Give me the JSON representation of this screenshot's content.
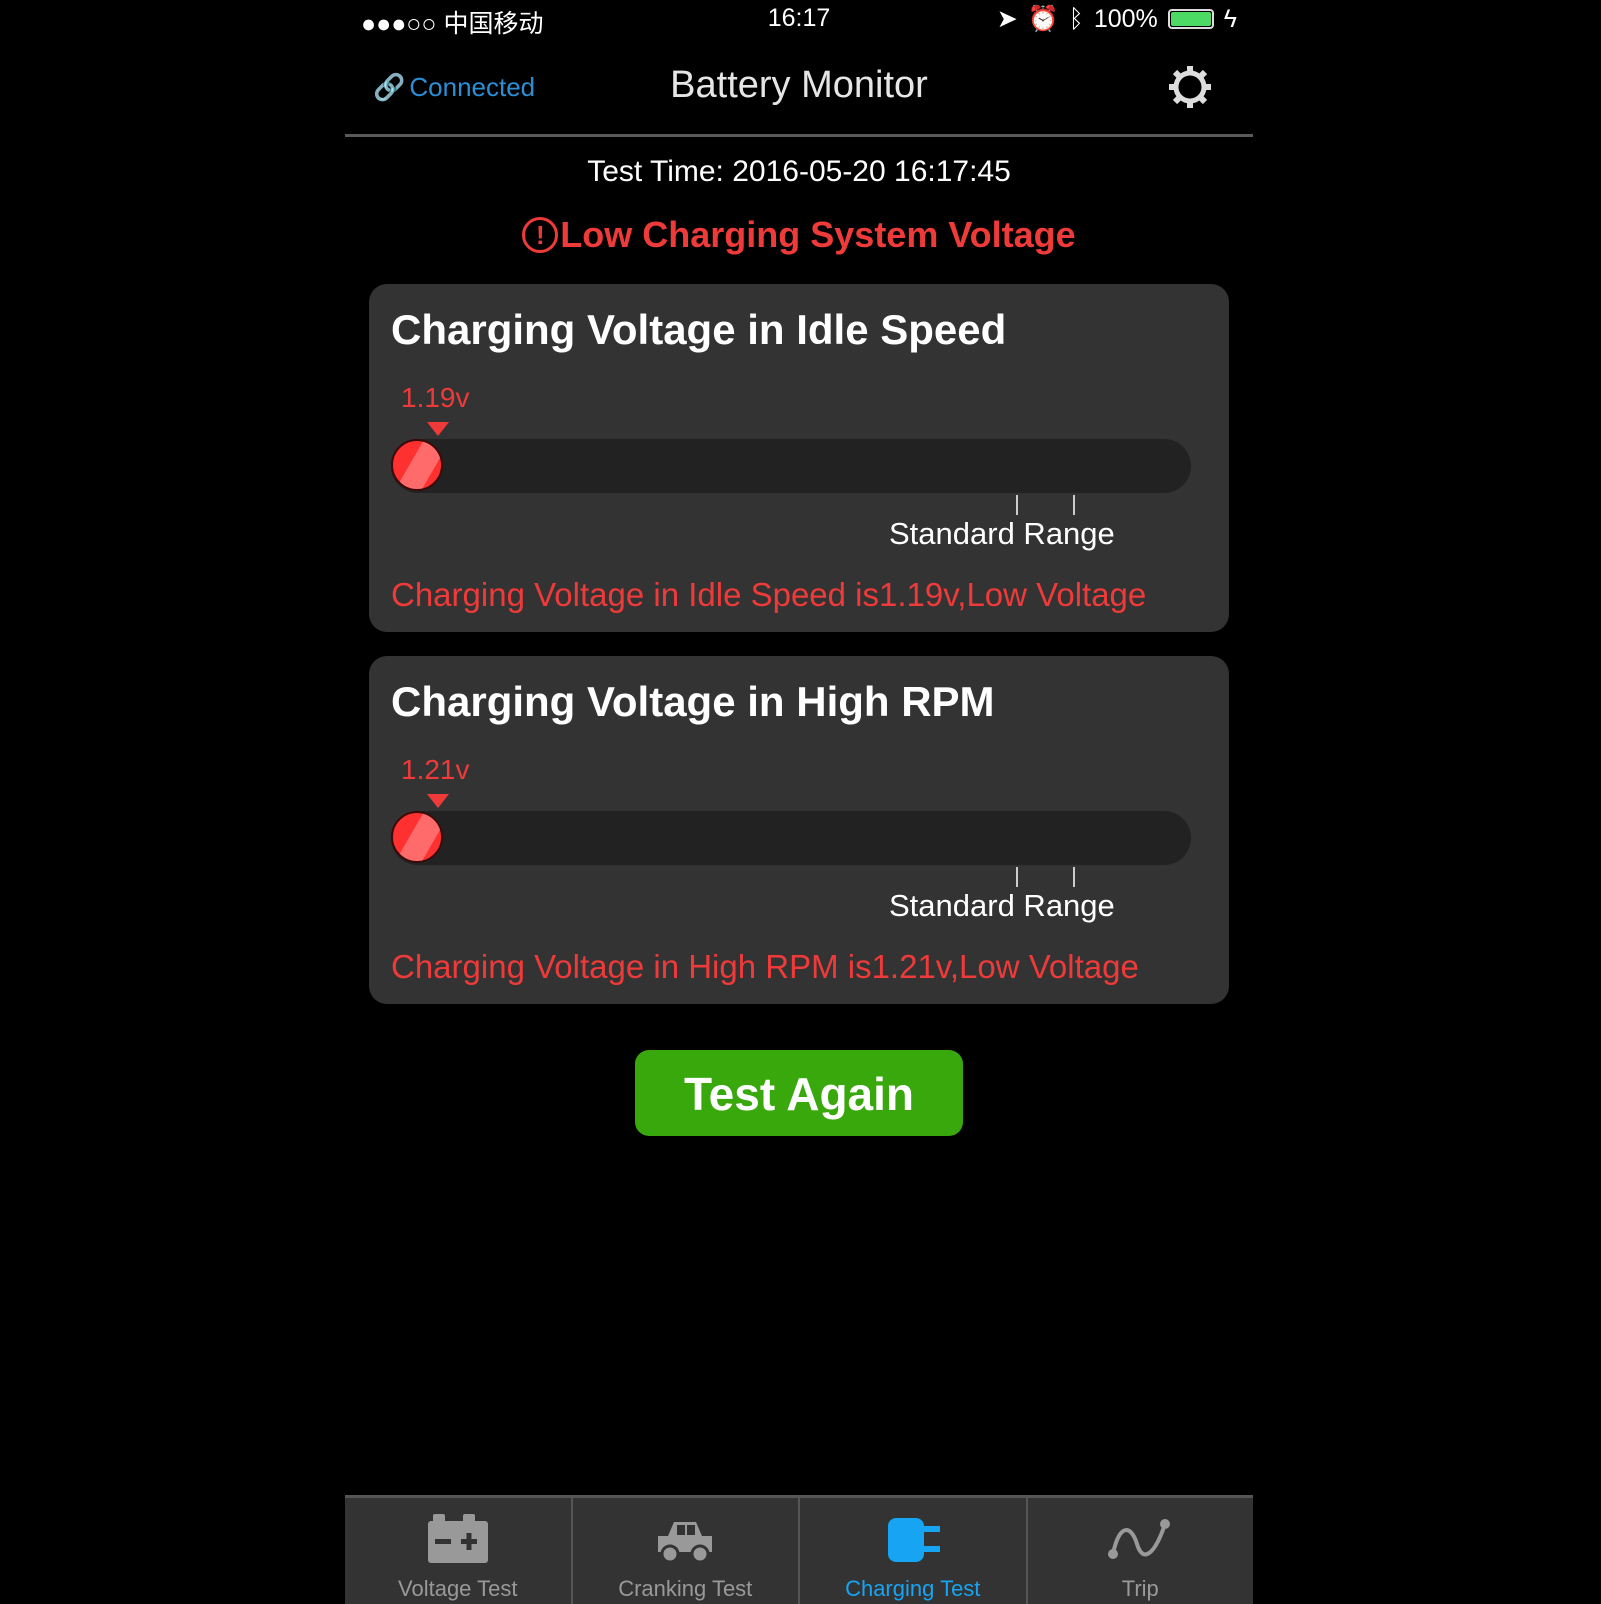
{
  "status_bar": {
    "carrier": "●●●○○ 中国移动",
    "time": "16:17",
    "battery": "100%"
  },
  "header": {
    "connection": "Connected",
    "title": "Battery Monitor"
  },
  "test_time": "Test Time:  2016-05-20 16:17:45",
  "alert": {
    "icon": "!",
    "text": "Low Charging System Voltage"
  },
  "cards": [
    {
      "title": "Charging Voltage in Idle Speed",
      "value_label": "1.19v",
      "value": 1.19,
      "range_label": "Standard Range",
      "message": "Charging Voltage in Idle Speed is1.19v,Low Voltage"
    },
    {
      "title": "Charging Voltage in High RPM",
      "value_label": "1.21v",
      "value": 1.21,
      "range_label": "Standard Range",
      "message": "Charging Voltage in High RPM is1.21v,Low Voltage"
    }
  ],
  "button": {
    "label": "Test Again"
  },
  "tabs": [
    {
      "label": "Voltage Test",
      "active": false
    },
    {
      "label": "Cranking Test",
      "active": false
    },
    {
      "label": "Charging Test",
      "active": true
    },
    {
      "label": "Trip",
      "active": false
    }
  ],
  "colors": {
    "accent": "#17a4f2",
    "alert": "#ef3a3a",
    "button": "#38a80d"
  }
}
